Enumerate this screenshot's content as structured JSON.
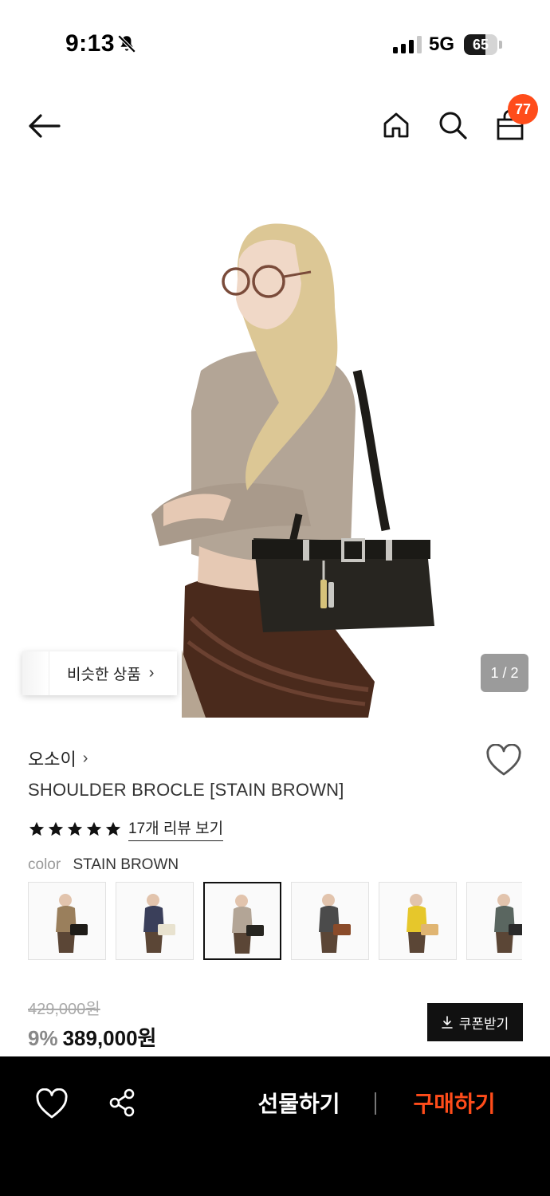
{
  "status_bar": {
    "time": "9:13",
    "network": "5G",
    "battery": "65",
    "battery_level": 0.65,
    "icons": [
      "bell-slash-icon",
      "signal-icon",
      "battery-icon"
    ]
  },
  "nav": {
    "icons": [
      "back-arrow-icon",
      "home-icon",
      "search-icon",
      "shopping-bag-icon"
    ],
    "cart_count": "77"
  },
  "hero": {
    "similar_label": "비슷한 상품",
    "page_indicator": "1 / 2"
  },
  "product": {
    "brand": "오소이",
    "title": "SHOULDER BROCLE [STAIN BROWN]",
    "rating_stars": 5,
    "review_link": "17개 리뷰 보기",
    "color_label": "color",
    "color_value": "STAIN BROWN",
    "swatch_count": 6,
    "selected_swatch": 3
  },
  "price": {
    "original": "429,000원",
    "discount_rate": "9%",
    "final": "389,000원",
    "coupon_label": "쿠폰받기"
  },
  "bottom_bar": {
    "gift_label": "선물하기",
    "buy_label": "구매하기"
  },
  "colors": {
    "accent": "#ff4c1a",
    "bottom_bar": "#000000",
    "indicator": "#9b9b9b"
  }
}
